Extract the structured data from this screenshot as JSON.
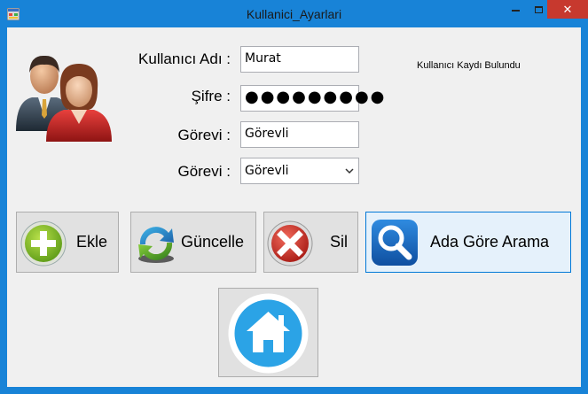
{
  "window": {
    "title": "Kullanici_Ayarlari",
    "close_glyph": "✕",
    "colors": {
      "titlebar": "#1883d7",
      "close": "#c7392e",
      "client": "#f0f0f0"
    }
  },
  "form": {
    "username_label": "Kullanıcı Adı :",
    "username_value": "Murat",
    "password_label": "Şifre :",
    "password_value": "●●●●●●●●●",
    "role_label": "Görevi :",
    "role_value": "Görevli",
    "role_select_label": "Görevi :",
    "role_select_value": "Görevli"
  },
  "status": {
    "text": "Kullanıcı Kaydı Bulundu"
  },
  "buttons": {
    "add": {
      "label": "Ekle",
      "icon": "plus-circle-icon"
    },
    "update": {
      "label": "Güncelle",
      "icon": "refresh-icon"
    },
    "delete": {
      "label": "Sil",
      "icon": "delete-x-icon"
    },
    "search": {
      "label": "Ada Göre Arama",
      "icon": "magnifier-icon"
    },
    "home": {
      "icon": "home-icon"
    }
  }
}
